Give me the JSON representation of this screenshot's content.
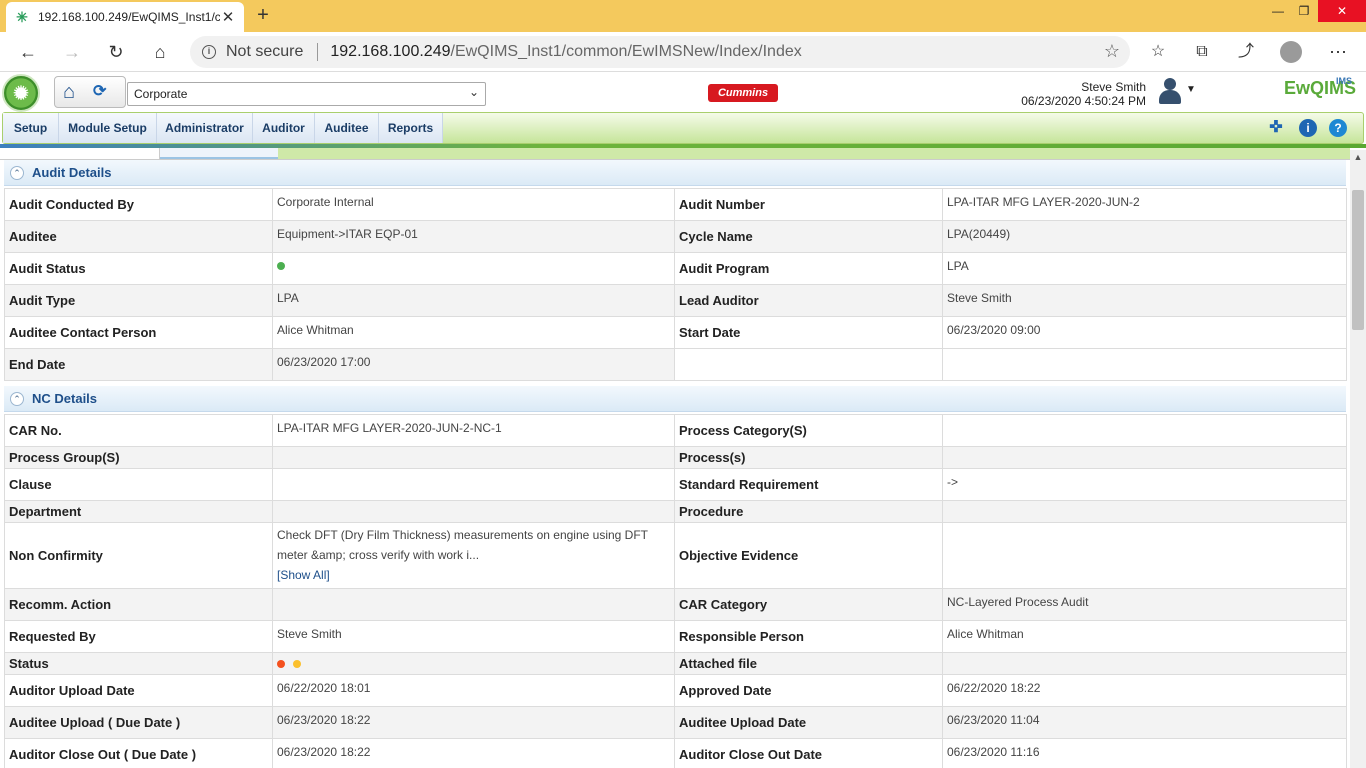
{
  "browser": {
    "tab_title": "192.168.100.249/EwQIMS_Inst1/c",
    "not_secure": "Not secure",
    "url_host": "192.168.100.249",
    "url_path": "/EwQIMS_Inst1/common/EwIMSNew/Index/Index"
  },
  "header": {
    "org_select_value": "Corporate",
    "brand_logo_text": "Cummins",
    "user_name": "Steve Smith",
    "datetime": "06/23/2020 4:50:24 PM",
    "app_logo_text": "EwQIMS"
  },
  "menu": {
    "items": [
      "Setup",
      "Module Setup",
      "Administrator",
      "Auditor",
      "Auditee",
      "Reports"
    ]
  },
  "audit_details": {
    "title": "Audit Details",
    "rows": [
      {
        "l1": "Audit Conducted By",
        "v1": "Corporate Internal",
        "l2": "Audit Number",
        "v2": "LPA-ITAR MFG LAYER-2020-JUN-2"
      },
      {
        "l1": "Auditee",
        "v1": "Equipment->ITAR EQP-01",
        "l2": "Cycle Name",
        "v2": "LPA(20449)"
      },
      {
        "l1": "Audit Status",
        "v1": "",
        "l2": "Audit Program",
        "v2": "LPA"
      },
      {
        "l1": "Audit Type",
        "v1": "LPA",
        "l2": "Lead Auditor",
        "v2": "Steve Smith"
      },
      {
        "l1": "Auditee Contact Person",
        "v1": "Alice Whitman",
        "l2": "Start Date",
        "v2": "06/23/2020 09:00"
      },
      {
        "l1": "End Date",
        "v1": "06/23/2020 17:00",
        "l2": "",
        "v2": ""
      }
    ],
    "audit_status_color": "#4caf50"
  },
  "nc_details": {
    "title": "NC Details",
    "rows": [
      {
        "l1": "CAR No.",
        "v1": "LPA-ITAR MFG LAYER-2020-JUN-2-NC-1",
        "l2": "Process Category(S)",
        "v2": ""
      },
      {
        "l1": "Process Group(S)",
        "v1": "",
        "l2": "Process(s)",
        "v2": ""
      },
      {
        "l1": "Clause",
        "v1": "",
        "l2": "Standard Requirement",
        "v2": "->"
      },
      {
        "l1": "Department",
        "v1": "",
        "l2": "Procedure",
        "v2": ""
      },
      {
        "l1": "Non Confirmity",
        "v1": "Check DFT (Dry Film Thickness) measurements on engine using DFT meter &amp; cross verify with work i...",
        "l2": "Objective Evidence",
        "v2": ""
      },
      {
        "l1": "Recomm. Action",
        "v1": "",
        "l2": "CAR Category",
        "v2": "NC-Layered Process Audit"
      },
      {
        "l1": "Requested By",
        "v1": "Steve Smith",
        "l2": "Responsible Person",
        "v2": "Alice Whitman"
      },
      {
        "l1": "Status",
        "v1": "",
        "l2": "Attached file",
        "v2": ""
      },
      {
        "l1": "Auditor Upload Date",
        "v1": "06/22/2020 18:01",
        "l2": "Approved Date",
        "v2": "06/22/2020 18:22"
      },
      {
        "l1": "Auditee Upload ( Due Date )",
        "v1": "06/23/2020 18:22",
        "l2": "Auditee Upload Date",
        "v2": "06/23/2020 11:04"
      },
      {
        "l1": "Auditor Close Out ( Due Date )",
        "v1": "06/23/2020 18:22",
        "l2": "Auditor Close Out Date",
        "v2": "06/23/2020 11:16"
      }
    ],
    "show_all": "[Show All]",
    "status_colors": [
      "#f4511e",
      "#fbc02d"
    ]
  }
}
